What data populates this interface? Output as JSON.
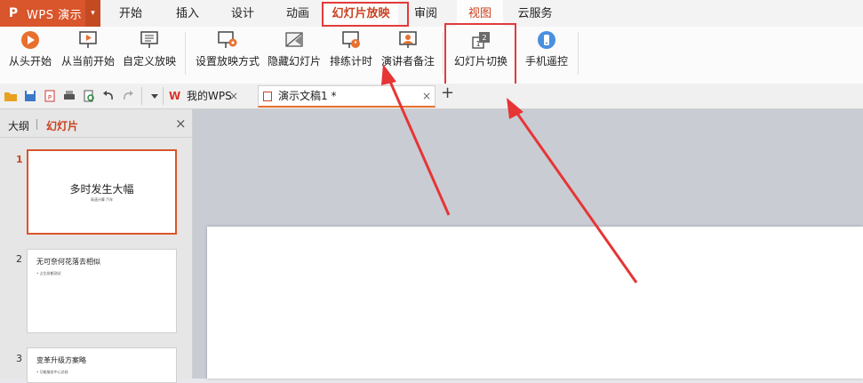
{
  "app": {
    "logo_glyph": "P",
    "name": "WPS 演示",
    "dropdown_glyph": "▾"
  },
  "menu": {
    "tabs": [
      "开始",
      "插入",
      "设计",
      "动画",
      "幻灯片放映",
      "审阅",
      "视图",
      "云服务"
    ],
    "current": "幻灯片放映"
  },
  "ribbon": {
    "buttons": [
      {
        "label": "从头开始"
      },
      {
        "label": "从当前开始"
      },
      {
        "label": "自定义放映"
      },
      {
        "label": "设置放映方式"
      },
      {
        "label": "隐藏幻灯片"
      },
      {
        "label": "排练计时"
      },
      {
        "label": "演讲者备注"
      },
      {
        "label": "幻灯片切换"
      },
      {
        "label": "手机遥控"
      }
    ]
  },
  "doc_tabs": [
    {
      "label": "我的WPS"
    },
    {
      "label": "演示文稿1 *"
    }
  ],
  "doc_tab_close": "×",
  "new_tab": "+",
  "panel": {
    "tab_outline": "大纲",
    "tab_slides": "幻灯片",
    "close": "×",
    "slides": [
      {
        "number": "1",
        "title": "多时发生大幅",
        "subtitle": "高速计算  汽车"
      },
      {
        "number": "2",
        "title": "无可奈何花落去相似",
        "bullet": "• 占比份额测试"
      },
      {
        "number": "3",
        "title": "变革升级方案略",
        "bullet": "• 功能服务中心总结"
      }
    ]
  },
  "colors": {
    "accent": "#d9552b",
    "highlight": "#e33a3a"
  }
}
